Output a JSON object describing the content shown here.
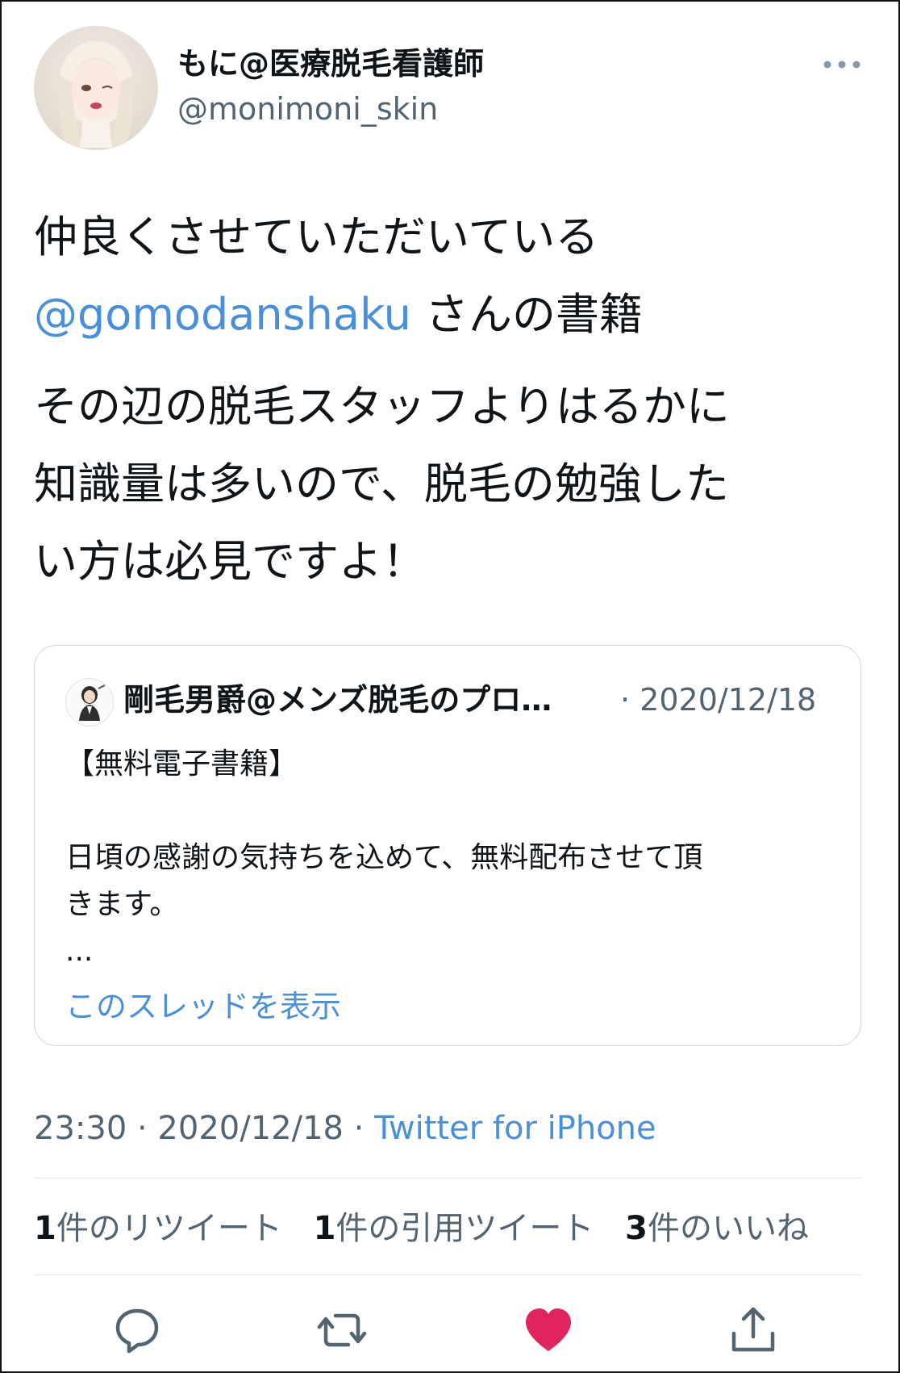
{
  "author": {
    "display_name": "もに@医療脱毛看護師",
    "handle": "@monimoni_skin"
  },
  "tweet": {
    "line1": "仲良くさせていただいている",
    "mention": "@gomodanshaku",
    "line2_rest": " さんの書籍",
    "para2_lines": [
      "その辺の脱毛スタッフよりはるかに",
      "知識量は多いので、脱毛の勉強した",
      "い方は必見ですよ！"
    ]
  },
  "quoted": {
    "display_name": "剛毛男爵@メンズ脱毛のプロ…",
    "date": "· 2020/12/18",
    "line1": "【無料電子書籍】",
    "line2": "日頃の感謝の気持ちを込めて、無料配布させて頂",
    "line3": "きます。",
    "line4": "...",
    "show_thread": "このスレッドを表示"
  },
  "meta": {
    "time": "23:30 · 2020/12/18 · ",
    "source": "Twitter for iPhone"
  },
  "stats": {
    "retweets_num": "1",
    "retweets_label": "件のリツイート",
    "quotes_num": "1",
    "quotes_label": "件の引用ツイート",
    "likes_num": "3",
    "likes_label": "件のいいね"
  },
  "icons": {
    "more": "more-icon",
    "reply": "reply-icon",
    "retweet": "retweet-icon",
    "like": "heart-icon",
    "share": "share-icon"
  },
  "colors": {
    "link": "#4a90d9",
    "like": "#e0245e",
    "secondary_text": "#536471",
    "border": "#cfd9de"
  }
}
